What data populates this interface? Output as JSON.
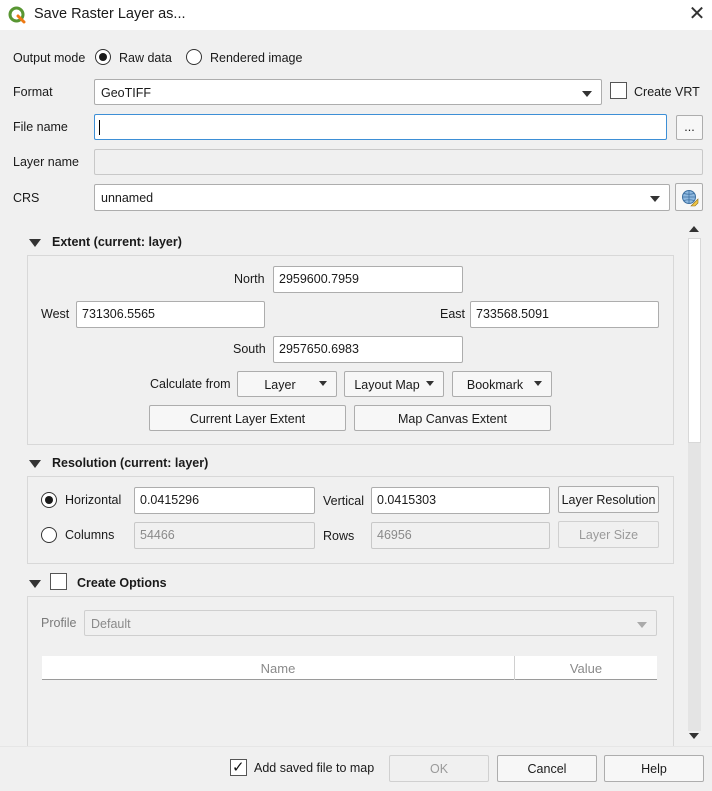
{
  "window": {
    "title": "Save Raster Layer as...",
    "close_symbol": "✕"
  },
  "output_mode": {
    "label": "Output mode",
    "options": [
      "Raw data",
      "Rendered image"
    ],
    "selected": "Raw data"
  },
  "format": {
    "label": "Format",
    "value": "GeoTIFF",
    "create_vrt_label": "Create VRT",
    "create_vrt_checked": false
  },
  "file_name": {
    "label": "File name",
    "value": "",
    "browse_label": "..."
  },
  "layer_name": {
    "label": "Layer name",
    "value": ""
  },
  "crs": {
    "label": "CRS",
    "value": "unnamed"
  },
  "extent": {
    "title": "Extent (current: layer)",
    "north_label": "North",
    "north": "2959600.7959",
    "west_label": "West",
    "west": "731306.5565",
    "east_label": "East",
    "east": "733568.5091",
    "south_label": "South",
    "south": "2957650.6983",
    "calculate_from_label": "Calculate from",
    "calc_buttons": [
      "Layer",
      "Layout Map",
      "Bookmark"
    ],
    "current_layer_extent": "Current Layer Extent",
    "map_canvas_extent": "Map Canvas Extent"
  },
  "resolution": {
    "title": "Resolution (current: layer)",
    "horizontal_label": "Horizontal",
    "horizontal": "0.0415296",
    "vertical_label": "Vertical",
    "vertical": "0.0415303",
    "layer_resolution": "Layer Resolution",
    "columns_label": "Columns",
    "columns": "54466",
    "rows_label": "Rows",
    "rows": "46956",
    "layer_size": "Layer Size",
    "selected": "Horizontal"
  },
  "create_options": {
    "title": "Create Options",
    "checked": false,
    "profile_label": "Profile",
    "profile": "Default",
    "table_headers": [
      "Name",
      "Value"
    ]
  },
  "footer": {
    "add_saved_file_label": "Add saved file to map",
    "add_saved_file_checked": true,
    "ok": "OK",
    "cancel": "Cancel",
    "help": "Help"
  }
}
